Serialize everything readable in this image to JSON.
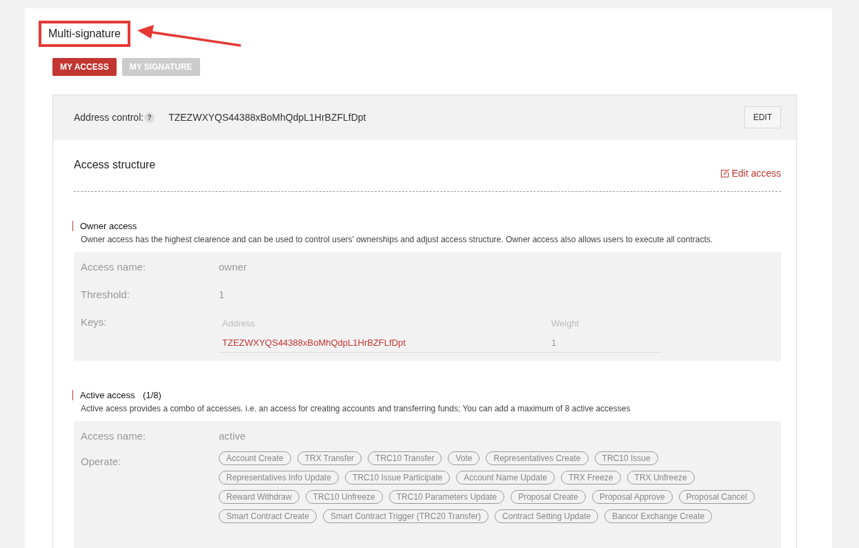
{
  "page_title": "Multi-signature",
  "tabs": [
    {
      "label": "MY ACCESS",
      "selected": true
    },
    {
      "label": "MY SIGNATURE",
      "selected": false
    }
  ],
  "address_control": {
    "label": "Address control:",
    "help": "?",
    "address": "TZEZWXYQS44388xBoMhQdpL1HrBZFLfDpt",
    "button": "EDIT"
  },
  "access_structure": {
    "title": "Access structure",
    "edit_link": "Edit access"
  },
  "owner": {
    "title": "Owner access",
    "description": "Owner access has the highest clearence and can be used to control users' ownerships and adjust access structure. Owner access also allows users to execute all contracts.",
    "name_label": "Access name:",
    "name": "owner",
    "threshold_label": "Threshold:",
    "threshold": "1",
    "keys_label": "Keys:",
    "keys_columns": [
      "Address",
      "Weight"
    ],
    "keys": [
      {
        "address": "TZEZWXYQS44388xBoMhQdpL1HrBZFLfDpt",
        "weight": "1"
      }
    ]
  },
  "active": {
    "title": "Active access",
    "count": "(1/8)",
    "description": "Active acess provides a combo of accesses. i.e. an access for creating accounts and transferring funds; You can add a maximum of 8 active accesses",
    "name_label": "Access name:",
    "name": "active",
    "operate_label": "Operate:",
    "operation_rows": [
      {
        "tags": [
          "Account Create",
          "TRX Transfer",
          "TRC10 Transfer",
          "Vote",
          "Representatives Create",
          "TRC10 Issue"
        ]
      },
      {
        "tags": [
          "Representatives Info Update",
          "TRC10 Issue Participate",
          "Account Name Update",
          "TRX Freeze",
          "TRX Unfreeze"
        ]
      },
      {
        "tags": [
          "Reward Withdraw",
          "TRC10 Unfreeze",
          "TRC10 Parameters Update",
          "Proposal Create",
          "Proposal Approve",
          "Proposal Cancel"
        ]
      },
      {
        "tags": [
          "Smart Contract Create",
          "Smart Contract Trigger (TRC20 Transfer)",
          "Contract Setting Update",
          "Bancor Exchange Create"
        ]
      }
    ]
  }
}
